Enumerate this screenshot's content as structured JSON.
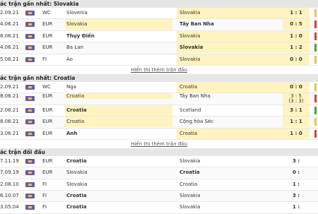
{
  "sections": [
    {
      "title": "ác trận gần nhất: Slovakia",
      "rows": [
        {
          "date": "2.09.21",
          "comp": "WC",
          "home": "Slovenia",
          "away": "Slovakia",
          "score": "1 : 1",
          "hl": "away",
          "bold": "",
          "mark": "#e8c34b"
        },
        {
          "date": "4.06.21",
          "comp": "EUR",
          "home": "Slovakia",
          "away": "Tây Ban Nha",
          "score": "0 : 5",
          "hl": "home",
          "bold": "away",
          "mark": "#e03a3a"
        },
        {
          "date": "8.06.21",
          "comp": "EUR",
          "home": "Thụy Điển",
          "away": "Slovakia",
          "score": "1 : 0",
          "hl": "away",
          "bold": "home",
          "mark": "#e03a3a"
        },
        {
          "date": "4.06.21",
          "comp": "EUR",
          "home": "Ba Lan",
          "away": "Slovakia",
          "score": "1 : 2",
          "hl": "away",
          "bold": "away",
          "mark": "#3fa83f"
        },
        {
          "date": "5.06.21",
          "comp": "FI",
          "home": "Áo",
          "away": "Slovakia",
          "score": "0 : 0",
          "hl": "away",
          "bold": "",
          "mark": "#e8c34b"
        }
      ],
      "more": "Hiển thị thêm trận đấu"
    },
    {
      "title": "ác trận gần nhất: Croatia",
      "rows": [
        {
          "date": "2.09.21",
          "comp": "WC",
          "home": "Nga",
          "away": "Croatia",
          "score": "0 : 0",
          "hl": "away",
          "bold": "",
          "mark": "#e8c34b"
        },
        {
          "date": "8.06.21",
          "comp": "EUR",
          "home": "Croatia",
          "away": "Tây Ban Nha",
          "score": "3 : 5",
          "score2": "(3 : 3)",
          "hl": "home",
          "bold": "",
          "mark": "#e03a3a"
        },
        {
          "date": "2.06.21",
          "comp": "EUR",
          "home": "Croatia",
          "away": "Scotland",
          "score": "3 : 1",
          "hl": "home",
          "bold": "home",
          "mark": "#3fa83f"
        },
        {
          "date": "8.06.21",
          "comp": "EUR",
          "home": "Croatia",
          "away": "Cộng hòa Séc",
          "score": "1 : 1",
          "hl": "home",
          "bold": "",
          "mark": "#e8c34b"
        },
        {
          "date": "3.06.21",
          "comp": "EUR",
          "home": "Anh",
          "away": "Croatia",
          "score": "1 : 0",
          "hl": "away",
          "bold": "home",
          "mark": "#e03a3a"
        }
      ],
      "more": "Hiển thị thêm trận đấu"
    },
    {
      "title": "ác trận đối đầu",
      "rows": [
        {
          "date": "7.11.19",
          "comp": "EUR",
          "home": "Croatia",
          "away": "Slovakia",
          "score": "3 :",
          "hl": "",
          "bold": "home",
          "mark": ""
        },
        {
          "date": "7.09.19",
          "comp": "EUR",
          "home": "Slovakia",
          "away": "Croatia",
          "score": "0 :",
          "hl": "",
          "bold": "away",
          "mark": ""
        },
        {
          "date": "2.08.10",
          "comp": "FI",
          "home": "Slovakia",
          "away": "Croatia",
          "score": "1 :",
          "hl": "",
          "bold": "",
          "mark": ""
        },
        {
          "date": "6.10.07",
          "comp": "FI",
          "home": "Croatia",
          "away": "Slovakia",
          "score": "3 :",
          "hl": "",
          "bold": "home",
          "mark": ""
        },
        {
          "date": "3.05.04",
          "comp": "FI",
          "home": "Croatia",
          "away": "Slovakia",
          "score": "1 :",
          "hl": "",
          "bold": "home",
          "mark": ""
        }
      ]
    }
  ]
}
